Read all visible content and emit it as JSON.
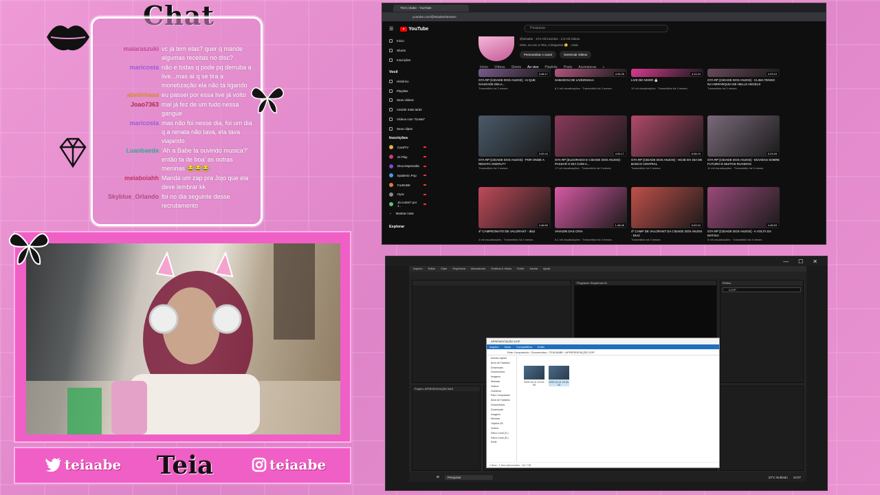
{
  "chat": {
    "title": "Chat",
    "messages": [
      {
        "user": "maiaraszuki",
        "text": "vc já tem elas? quer q mande algumas receitas no disc?",
        "color": "#c44a9a"
      },
      {
        "user": "maricosta",
        "text": "não e todas q pode pq derruba a live...mas aí q se tira a monetização ela não tá ligando",
        "color": "#9a5cd6"
      },
      {
        "user": "abelinhaaa",
        "text": "eu passei por essa live já volto",
        "color": "#d68a2e"
      },
      {
        "user": "Joao7363",
        "text": "mal já fez de um tudo nessa gangue",
        "color": "#b02a4c"
      },
      {
        "user": "maricosta",
        "text": "mas não foi nesse dia, foi um dia q a renata não tava, ela tava viajando",
        "color": "#9a5cd6"
      },
      {
        "user": "Luanbaeda",
        "text": "'Ah a Babe ta ouvindo musica?' então ta de boa' as outras meninas 😂😂😂",
        "color": "#2fa88f"
      },
      {
        "user": "meiaboiahh",
        "text": "Manda um zap pra Jojo que ela deve lembrar kk",
        "color": "#c23262"
      },
      {
        "user": "Skyblue_Orlando",
        "text": "foi no dia seguinte desse recrutamento",
        "color": "#b24d7e"
      }
    ]
  },
  "footer": {
    "twitter_handle": "teiaabe",
    "instagram_handle": "teiaabe",
    "logo_text": "Teia"
  },
  "youtube": {
    "tab_title": "TEIA | Babe - YouTube",
    "url": "youtube.com/@teiaabe/streams",
    "search_placeholder": "Pesquisar",
    "sidebar": {
      "main": [
        "Início",
        "Shorts",
        "Inscrições"
      ],
      "voce_header": "Você",
      "voce": [
        "Histórico",
        "Playlists",
        "Seus vídeos",
        "Assistir mais tarde",
        "Vídeos com \"Gostei\"",
        "Seus clipes"
      ],
      "subs_header": "Inscrições",
      "subs": [
        {
          "name": "CazéTV",
          "color": "#e2b23a"
        },
        {
          "name": "Gi Play",
          "color": "#d13c7a"
        },
        {
          "name": "Diva Depressão",
          "color": "#7e4bd1"
        },
        {
          "name": "Epidemic Pop",
          "color": "#3fa0e0"
        },
        {
          "name": "FurBABE",
          "color": "#e07a3f"
        },
        {
          "name": "Hyra",
          "color": "#8a8a8a"
        },
        {
          "name": "Já contei? por J...",
          "color": "#5fbf77"
        }
      ],
      "show_more": "Mostrar mais",
      "explore": "Explorar"
    },
    "channel": {
      "handle": "@teiaabe · 272 mil inscritos · 2,8 mil vídeos",
      "description": "Oiee, eu sou a Teia, a blogueira 😊 ...mais",
      "customize_button": "Personalizar o canal",
      "manage_button": "Gerenciar vídeos"
    },
    "tabs": [
      "Início",
      "Vídeos",
      "Shorts",
      "Ao vivo",
      "Playlists",
      "Posts",
      "Assinaturas"
    ],
    "active_tab": "Ao vivo",
    "videos": [
      {
        "title": "GTA RP [CIDADE DOS ANJOS] - AI QUE SAUDADE DELA...",
        "meta": "Transmitido há 3 meses",
        "duration": "4:48:17",
        "thumb": "#7a5a8a"
      },
      {
        "title": "SABADOU DE LIVEZINHAA",
        "meta": "8,1 mil visualizações · Transmitido há 3 meses",
        "duration": "4:34:25",
        "thumb": "#b0577e"
      },
      {
        "title": "LIVE DE NIVER 🎂",
        "meta": "12 mil visualizações · Transmitido há 3 meses",
        "duration": "4:11:24",
        "thumb": "#d63b8f"
      },
      {
        "title": "GTA RP [CIDADE DOS ANJOS] - CLIMA TENSO NA HIERARQUIA DE HELLS ANGELS",
        "meta": "Transmitido há 3 meses",
        "duration": "4:23:10",
        "thumb": "#6a4a5a"
      },
      {
        "title": "GTA RP [CIDADE DOS ANJOS] - POR ONDE A RENATA ANDOU??",
        "meta": "Transmitido há 3 meses",
        "duration": "3:32:24",
        "thumb": "#4a5a6a"
      },
      {
        "title": "GTA RP [ELDORADO E CIDADE DOS ANJOS] - PASSAR O DIA COM A...",
        "meta": "17 mil visualizações · Transmitido há 3 meses",
        "duration": "4:34:17",
        "thumb": "#8a3a5a"
      },
      {
        "title": "GTA RP [CIDADE DOS ANJOS] - HOJE EH DIA DE BANCO CENTRAL",
        "meta": "Transmitido há 3 meses",
        "duration": "5:36:19",
        "thumb": "#b04a6a"
      },
      {
        "title": "GTA RP [CIDADE DOS ANJOS] - DÚVIDAS SOBRE FUTURO E MUITOS RUGIDOS",
        "meta": "11 mil visualizações · Transmitido há 3 meses",
        "duration": "5:23:28",
        "thumb": "#7a6a7a"
      },
      {
        "title": "4º CAMPEONATO DE VALORANT - dia2",
        "meta": "4 mil visualizações · Transmitido há 3 meses",
        "duration": "4:46:50",
        "thumb": "#c04a5a"
      },
      {
        "title": "VAVAZIN DAS CRIA",
        "meta": "5,1 mil visualizações · Transmitido há 3 meses",
        "duration": "1:48:45",
        "thumb": "#d85aa5"
      },
      {
        "title": "4º CAMP DE VALORANT DA CIDADE DOS ANJOS - DIA2",
        "meta": "Transmitido há 3 meses",
        "duration": "5:02:04",
        "thumb": "#c0504a"
      },
      {
        "title": "GTA RP [CIDADE DOS ANJOS] - A VOLTA DA MATSUI",
        "meta": "5 mil visualizações · Transmitido há 3 meses",
        "duration": "4:45:53",
        "thumb": "#9a4a7a"
      }
    ]
  },
  "premiere": {
    "menu": [
      "Arquivo",
      "Editar",
      "Clipe",
      "Sequência",
      "Marcadores",
      "Gráficos e títulos",
      "Exibir",
      "Janela",
      "Ajuda"
    ],
    "project_title": "Projeto: APRESENTAÇÃO BAII",
    "effects_title": "Efeitos",
    "program_title": "Programa: Sequência 01",
    "search_value": "LCCP",
    "explorer": {
      "title": "APRESENTAÇÃO DOP",
      "ribbon": [
        "Arquivo",
        "Início",
        "Compartilhar",
        "Exibir"
      ],
      "path": "Este Computador › Documentos › TEIA BABE › APRESENTAÇÃO DOP",
      "nav": [
        "Acesso rápido",
        "Área de Trabalho",
        "Downloads",
        "Documentos",
        "Imagens",
        "Músicas",
        "Vídeos",
        "OneDrive",
        "Este Computador",
        "Área de Trabalho",
        "Documentos",
        "Downloads",
        "Imagens",
        "Músicas",
        "Objetos 3D",
        "Vídeos",
        "Disco Local (C:)",
        "Disco Local (D:)",
        "Rede"
      ],
      "files": [
        "2025-10-01 19-18-55",
        "2025-10-01 19-34-32"
      ],
      "status": "2 itens · 1 item selecionado · 16,7 GB"
    },
    "taskbar_search": "Pesquisar",
    "taskbar_weather": "23°C Nublado",
    "taskbar_time": "10:07"
  },
  "colors": {
    "background": "#e58fcf",
    "frame_pink": "#f05fc6",
    "youtube_red": "#ff0000"
  }
}
